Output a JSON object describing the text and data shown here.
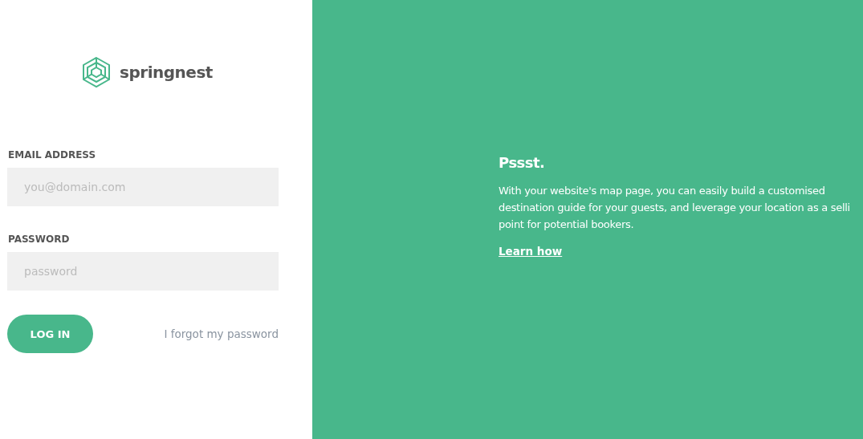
{
  "brand": {
    "name": "springnest"
  },
  "form": {
    "fields": [
      {
        "label": "EMAIL ADDRESS",
        "placeholder": "you@domain.com"
      },
      {
        "label": "PASSWORD",
        "placeholder": "password"
      }
    ],
    "submit": "LOG IN",
    "forgot_link": "I forgot my password"
  },
  "promo": {
    "title": "Pssst.",
    "body_lines": [
      "With your website's map page, you can easily build a customised",
      "destination guide for your guests, and leverage your location as a selli",
      "point for potential bookers."
    ],
    "link": "Learn how"
  }
}
